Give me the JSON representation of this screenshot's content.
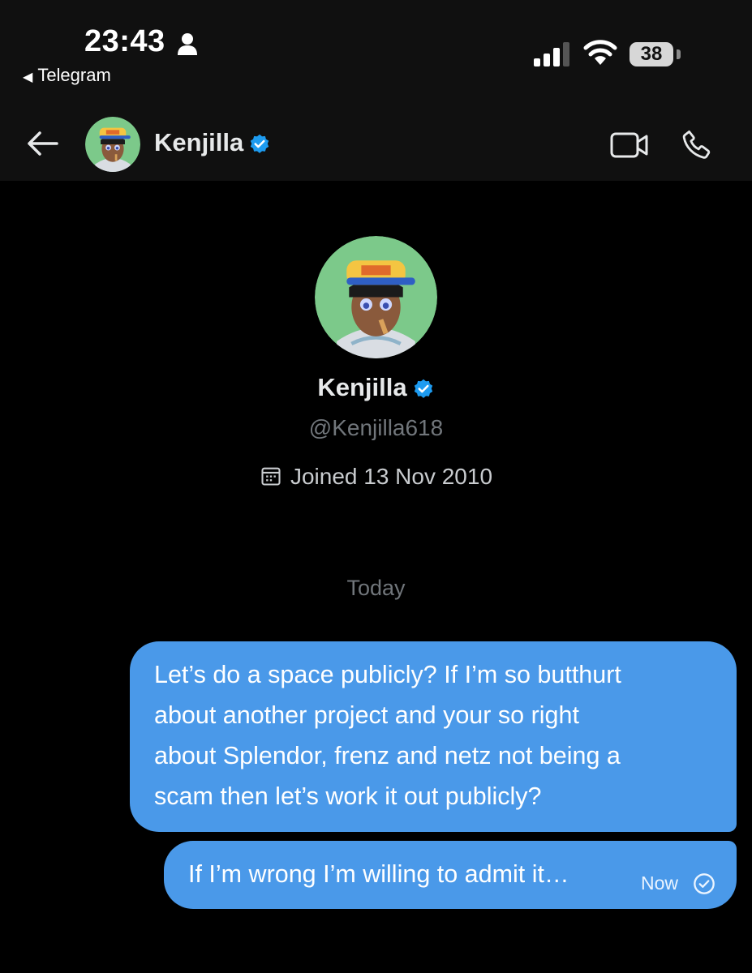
{
  "status_bar": {
    "time": "23:43",
    "back_app_label": "Telegram",
    "battery": "38"
  },
  "header": {
    "contact_name": "Kenjilla",
    "verified": true
  },
  "profile": {
    "name": "Kenjilla",
    "handle": "@Kenjilla618",
    "joined": "Joined 13 Nov 2010"
  },
  "date_separator": "Today",
  "messages": [
    {
      "text": "Let’s do a space publicly? If I’m so butthurt\nabout another project and your so right\nabout Splendor, frenz and netz not being a\nscam then let’s work it out publicly?"
    },
    {
      "text": "If I’m wrong I’m willing to admit it…",
      "timestamp": "Now"
    }
  ],
  "colors": {
    "bubble": "#4a99e9",
    "verified_badge": "#1d9bf0",
    "background": "#000000",
    "bar": "#101010"
  }
}
